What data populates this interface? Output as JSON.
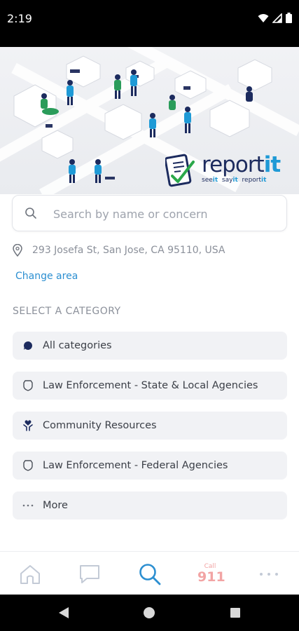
{
  "status_bar": {
    "time": "2:19"
  },
  "hero": {
    "brand_name_main": "report",
    "brand_name_accent": "it",
    "brand_tag": {
      "see": "see",
      "say": "say",
      "report": "report",
      "it": "it"
    }
  },
  "search": {
    "placeholder": "Search by name or concern"
  },
  "location": {
    "address": "293 Josefa St, San Jose, CA 95110, USA",
    "change_label": "Change area"
  },
  "categories": {
    "section_title": "SELECT A CATEGORY",
    "items": [
      {
        "label": "All categories",
        "icon": "chat-bubble-icon"
      },
      {
        "label": "Law Enforcement - State & Local Agencies",
        "icon": "badge-shield-icon"
      },
      {
        "label": "Community Resources",
        "icon": "hands-heart-icon"
      },
      {
        "label": "Law Enforcement - Federal Agencies",
        "icon": "badge-shield-icon"
      },
      {
        "label": "More",
        "icon": "ellipsis-icon"
      }
    ]
  },
  "bottom_nav": {
    "items": [
      "home-icon",
      "chat-icon",
      "search-icon",
      "call-911",
      "more-icon"
    ],
    "call_label": "Call",
    "call_number": "911",
    "active": "search-icon",
    "accent_color": "#2c8fd1",
    "call_color": "#f2a4a4"
  }
}
